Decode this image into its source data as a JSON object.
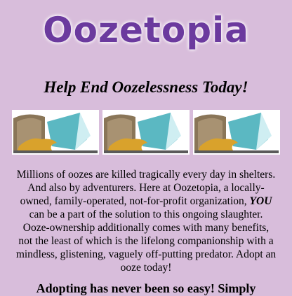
{
  "header": {
    "title": "Oozetopia",
    "tagline": "Help End Oozelessness Today!"
  },
  "images": [
    {
      "alt": "ooze-illustration"
    },
    {
      "alt": "ooze-illustration"
    },
    {
      "alt": "ooze-illustration"
    }
  ],
  "intro": {
    "before": "Millions of oozes are killed tragically every day in shelters. And also by adventurers. Here at Oozetopia, a locally-owned, family-operated, not-for-profit organization, ",
    "emphasis": "YOU",
    "after": " can be a part of the solution to this ongoing slaughter. Ooze-ownership additionally comes with many benefits, not the least of which is the lifelong companionship with a mindless, glistening, vaguely off-putting predator. Adopt an ooze today!"
  },
  "adopt_heading": "Adopting has never been so easy! Simply",
  "colors": {
    "background": "#d8bddb",
    "title": "#6b3a9e"
  }
}
